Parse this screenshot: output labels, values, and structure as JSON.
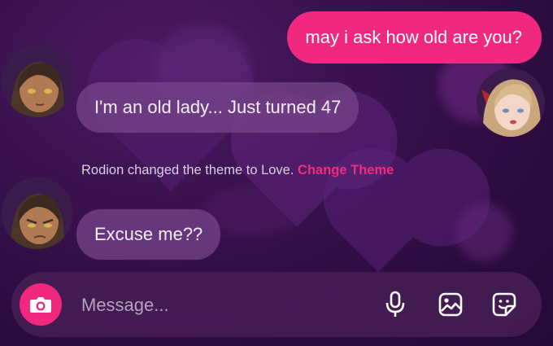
{
  "messages": {
    "outgoing_1": "may i ask how old are you?",
    "incoming_1": "I'm an old lady... Just turned 47",
    "incoming_2": "Excuse me??"
  },
  "system_notice": {
    "text": "Rodion changed the theme to Love.",
    "action": "Change Theme"
  },
  "composer": {
    "placeholder": "Message..."
  },
  "icons": {
    "camera": "camera-icon",
    "microphone": "microphone-icon",
    "gallery": "image-gallery-icon",
    "sticker": "sticker-icon"
  },
  "colors": {
    "accent": "#f0287e",
    "background": "#3a124f",
    "incoming_bubble": "#784690"
  }
}
